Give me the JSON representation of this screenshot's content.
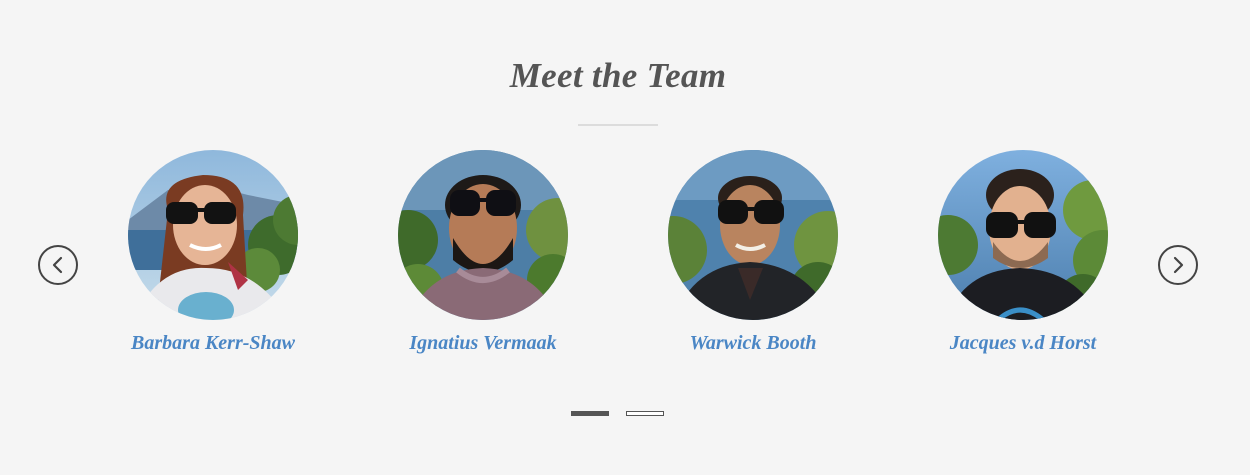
{
  "section": {
    "title": "Meet the Team"
  },
  "team": [
    {
      "name": "Barbara Kerr-Shaw",
      "photo": "portrait-woman-sunglasses"
    },
    {
      "name": "Ignatius Vermaak",
      "photo": "portrait-man-beard-sunglasses"
    },
    {
      "name": "Warwick Booth",
      "photo": "portrait-man-sunglasses"
    },
    {
      "name": "Jacques v.d Horst",
      "photo": "portrait-man-sunglasses-black-tee"
    }
  ],
  "carousel": {
    "prev_icon": "chevron-left-icon",
    "next_icon": "chevron-right-icon",
    "pages": 2,
    "active_page": 1
  },
  "colors": {
    "background": "#f5f5f5",
    "title": "#555555",
    "name_link": "#4a86c5",
    "control": "#444444"
  }
}
